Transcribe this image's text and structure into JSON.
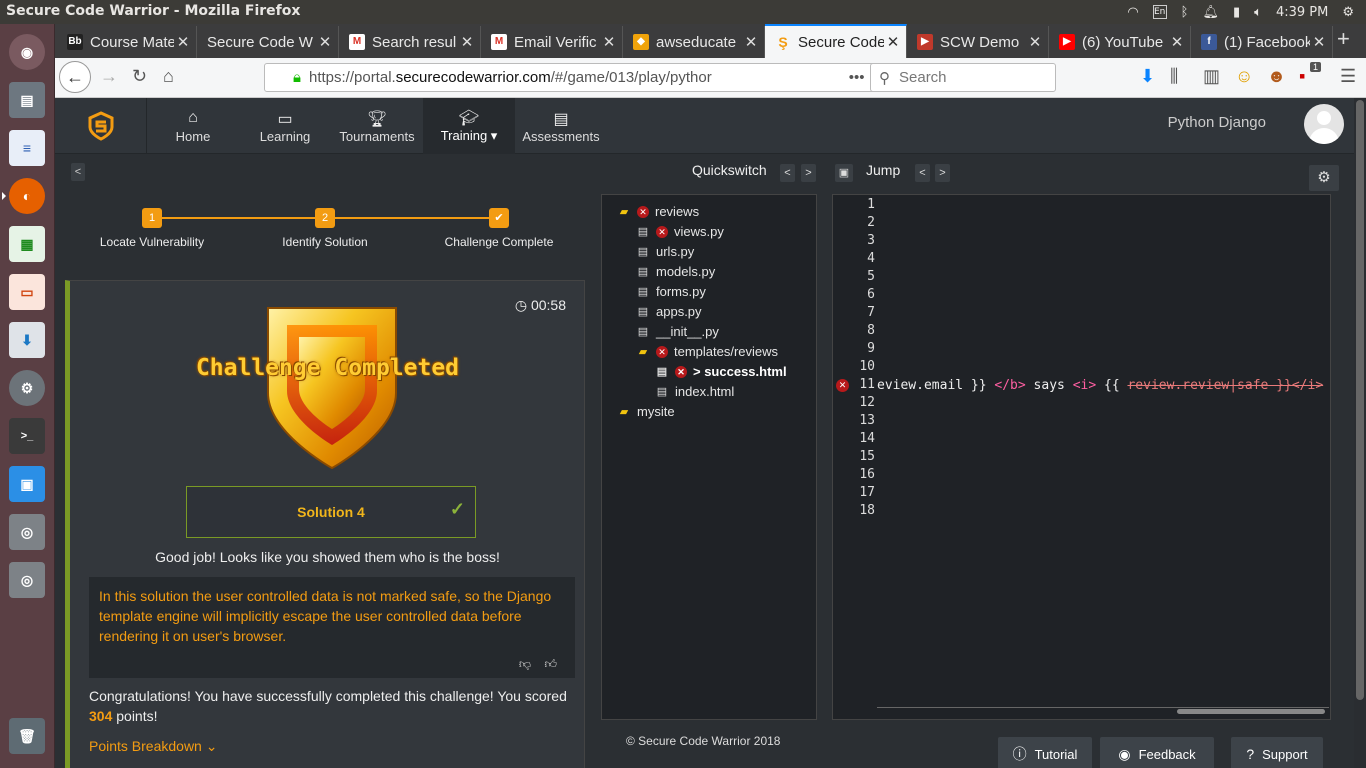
{
  "os": {
    "window_title": "Secure Code Warrior - Mozilla Firefox",
    "keyboard": "En",
    "clock": "4:39 PM"
  },
  "browser": {
    "tabs": [
      {
        "label": "Course Mate",
        "icon": "bb-icon",
        "color": "#222"
      },
      {
        "label": "Secure Code W",
        "icon": "",
        "color": ""
      },
      {
        "label": "Search resul",
        "icon": "gmail-icon",
        "color": "#d93025"
      },
      {
        "label": "Email Verific",
        "icon": "gmail-icon",
        "color": "#d93025"
      },
      {
        "label": "awseducate",
        "icon": "aws-icon",
        "color": "#f0a30a"
      },
      {
        "label": "Secure Code",
        "icon": "scw-icon",
        "color": "#f39c12"
      },
      {
        "label": "SCW Demo",
        "icon": "video-icon",
        "color": "#c0392b"
      },
      {
        "label": "(6) YouTube",
        "icon": "youtube-icon",
        "color": "#ff0000"
      },
      {
        "label": "(1) Facebook",
        "icon": "facebook-icon",
        "color": "#3b5998"
      }
    ],
    "url_prefix": "https://portal.",
    "url_domain": "securecodewarrior.com",
    "url_path": "/#/game/013/play/pythor",
    "search_placeholder": "Search",
    "badge_count": "1"
  },
  "app": {
    "nav": [
      {
        "label": "Home",
        "icon": "home-icon"
      },
      {
        "label": "Learning",
        "icon": "monitor-icon"
      },
      {
        "label": "Tournaments",
        "icon": "trophy-icon"
      },
      {
        "label": "Training ▾",
        "icon": "graduation-cap-icon"
      },
      {
        "label": "Assessments",
        "icon": "document-icon"
      }
    ],
    "language": "Python Django"
  },
  "steps": [
    {
      "num": "1",
      "label": "Locate Vulnerability"
    },
    {
      "num": "2",
      "label": "Identify Solution"
    },
    {
      "num": "✔",
      "label": "Challenge Complete"
    }
  ],
  "result": {
    "timer": "00:58",
    "badge_title": "Challenge Completed",
    "solution": "Solution 4",
    "good_job": "Good job! Looks like you showed them who is the boss!",
    "explanation": "In this solution the user controlled data is not marked safe, so the Django template engine will implicitly escape the user controlled data before rendering it on user's browser.",
    "congrats_pre": "Congratulations! You have successfully completed this challenge! You scored ",
    "points": "304",
    "congrats_post": " points!",
    "breakdown": "Points Breakdown"
  },
  "quickswitch": {
    "label": "Quickswitch",
    "prev": "<",
    "next": ">"
  },
  "jump": {
    "label": "Jump",
    "prev": "<",
    "next": ">"
  },
  "filetree": [
    {
      "name": "reviews",
      "type": "folder",
      "error": true
    },
    {
      "name": "views.py",
      "type": "file",
      "error": true
    },
    {
      "name": "urls.py",
      "type": "file",
      "error": false
    },
    {
      "name": "models.py",
      "type": "file",
      "error": false
    },
    {
      "name": "forms.py",
      "type": "file",
      "error": false
    },
    {
      "name": "apps.py",
      "type": "file",
      "error": false
    },
    {
      "name": "__init__.py",
      "type": "file",
      "error": false
    },
    {
      "name": "templates/reviews",
      "type": "folder",
      "error": true
    },
    {
      "name": "> success.html",
      "type": "file",
      "error": true
    },
    {
      "name": "index.html",
      "type": "file",
      "error": false
    },
    {
      "name": "mysite",
      "type": "folder",
      "error": false
    }
  ],
  "editor": {
    "line_numbers": [
      "1",
      "2",
      "3",
      "4",
      "5",
      "6",
      "7",
      "8",
      "9",
      "10",
      "11",
      "12",
      "13",
      "14",
      "15",
      "16",
      "17",
      "18"
    ],
    "code": {
      "a": "eview.email }} ",
      "b": "</b>",
      "c": " says ",
      "d": "<i>",
      "e": " {{ ",
      "f": "review.review|safe }}</i>"
    }
  },
  "footer": {
    "copyright": "© Secure Code Warrior 2018",
    "tutorial": "Tutorial",
    "feedback": "Feedback",
    "support": "Support"
  },
  "colors": {
    "accent": "#f39c12",
    "success": "#7a9a25",
    "error": "#b7191b"
  }
}
